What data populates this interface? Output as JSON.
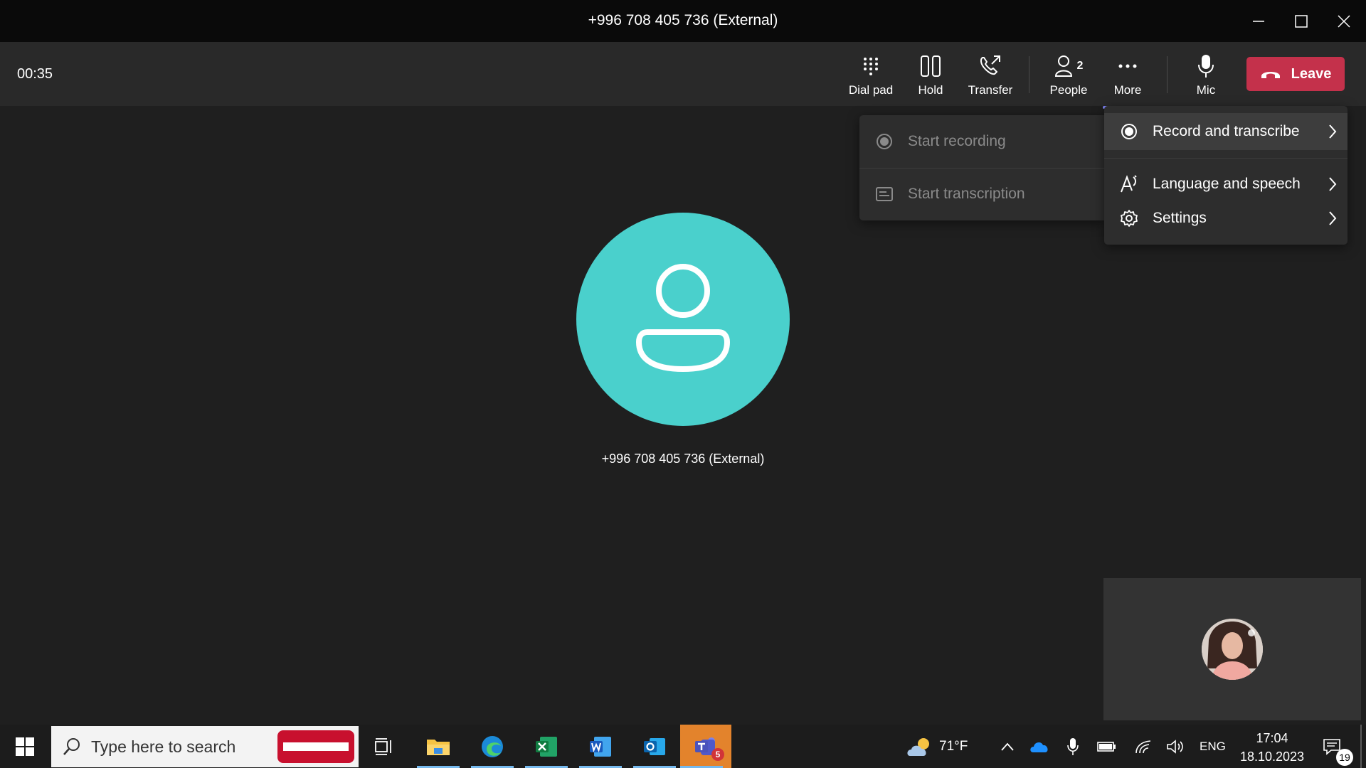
{
  "window": {
    "title": "+996 708 405 736 (External)"
  },
  "toolbar": {
    "timer": "00:35",
    "dial_pad": "Dial pad",
    "hold": "Hold",
    "transfer": "Transfer",
    "people": "People",
    "people_count": "2",
    "more": "More",
    "mic": "Mic",
    "leave": "Leave"
  },
  "stage": {
    "remote_name": "+996 708 405 736 (External)"
  },
  "more_menu": {
    "items": [
      {
        "label": "Record and transcribe",
        "icon": "record-icon"
      },
      {
        "label": "Language and speech",
        "icon": "language-icon"
      },
      {
        "label": "Settings",
        "icon": "gear-icon"
      }
    ]
  },
  "record_submenu": {
    "items": [
      {
        "label": "Start recording",
        "icon": "record-icon",
        "disabled": true
      },
      {
        "label": "Start transcription",
        "icon": "transcript-icon",
        "disabled": true
      }
    ]
  },
  "taskbar": {
    "search_placeholder": "Type here to search",
    "weather": "71°F",
    "language": "ENG",
    "time": "17:04",
    "date": "18.10.2023",
    "notification_count": "19",
    "teams_badge": "5"
  },
  "colors": {
    "accent": "#7f85f5",
    "leave": "#c4314b",
    "avatar": "#4ad0cc"
  }
}
